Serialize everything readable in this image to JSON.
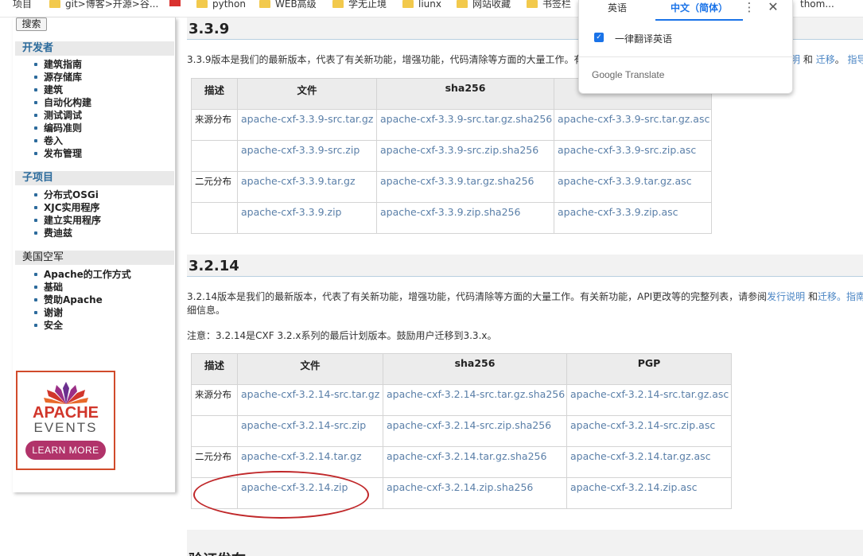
{
  "bookmarks": [
    "项目",
    "git>博客>开源>谷...",
    "python",
    "WEB高级",
    "学无止境",
    "liunx",
    "网站收藏",
    "书签栏",
    "thom..."
  ],
  "sidebar": {
    "search_button": "搜索",
    "developers_title": "开发者",
    "developers_items": [
      "建筑指南",
      "源存储库",
      "建筑",
      "自动化构建",
      "测试调试",
      "编码准则",
      "卷入",
      "发布管理"
    ],
    "subprojects_title": "子项目",
    "subprojects_items": [
      "分布式OSGi",
      "XJC实用程序",
      "建立实用程序",
      "费迪兹"
    ],
    "asf_title": "美国空军",
    "asf_items": [
      "Apache的工作方式",
      "基础",
      "赞助Apache",
      "谢谢",
      "安全"
    ]
  },
  "ad": {
    "title1": "APACHE",
    "title2": "EVENTS",
    "button": "LEARN MORE"
  },
  "release_339": {
    "heading": "3.3.9",
    "intro": "3.3.9版本是我们的最新版本，代表了有关新功能，增强功能，代码清除等方面的大量工作。有",
    "intro_links": [
      "明",
      "和",
      "迁移",
      "。",
      "指导"
    ],
    "table": {
      "headers": [
        "描述",
        "文件",
        "sha256"
      ],
      "rows": [
        [
          "来源分布",
          "apache-cxf-3.3.9-src.tar.gz",
          "apache-cxf-3.3.9-src.tar.gz.sha256",
          "apache-cxf-3.3.9-src.tar.gz.asc"
        ],
        [
          "",
          "apache-cxf-3.3.9-src.zip",
          "apache-cxf-3.3.9-src.zip.sha256",
          "apache-cxf-3.3.9-src.zip.asc"
        ],
        [
          "二元分布",
          "apache-cxf-3.3.9.tar.gz",
          "apache-cxf-3.3.9.tar.gz.sha256",
          "apache-cxf-3.3.9.tar.gz.asc"
        ],
        [
          "",
          "apache-cxf-3.3.9.zip",
          "apache-cxf-3.3.9.zip.sha256",
          "apache-cxf-3.3.9.zip.asc"
        ]
      ]
    }
  },
  "release_3214": {
    "heading": "3.2.14",
    "intro": "3.2.14版本是我们的最新版本，代表了有关新功能，增强功能，代码清除等方面的大量工作。有关新功能，API更改等的完整列表，请参阅",
    "intro_link1": "发行说明",
    "intro_and": "和",
    "intro_link2": "迁移",
    "intro_link3": "。指南",
    "intro_line2": "细信息。",
    "note": "注意：3.2.14是CXF 3.2.x系列的最后计划版本。鼓励用户迁移到3.3.x。",
    "table": {
      "headers": [
        "描述",
        "文件",
        "sha256",
        "PGP"
      ],
      "rows": [
        [
          "来源分布",
          "apache-cxf-3.2.14-src.tar.gz",
          "apache-cxf-3.2.14-src.tar.gz.sha256",
          "apache-cxf-3.2.14-src.tar.gz.asc"
        ],
        [
          "",
          "apache-cxf-3.2.14-src.zip",
          "apache-cxf-3.2.14-src.zip.sha256",
          "apache-cxf-3.2.14-src.zip.asc"
        ],
        [
          "二元分布",
          "apache-cxf-3.2.14.tar.gz",
          "apache-cxf-3.2.14.tar.gz.sha256",
          "apache-cxf-3.2.14.tar.gz.asc"
        ],
        [
          "",
          "apache-cxf-3.2.14.zip",
          "apache-cxf-3.2.14.zip.sha256",
          "apache-cxf-3.2.14.zip.asc"
        ]
      ]
    }
  },
  "bottom_heading": "验证发布",
  "translate": {
    "source_tab": "英语",
    "target_tab": "中文（简体）",
    "more_icon": "⋮",
    "close_icon": "✕",
    "always_label": "一律翻译英语",
    "brand": "Google Translate"
  },
  "colors": {
    "link": "#4a85c4",
    "annotation": "#c0282a",
    "accent": "#1a73e8"
  }
}
